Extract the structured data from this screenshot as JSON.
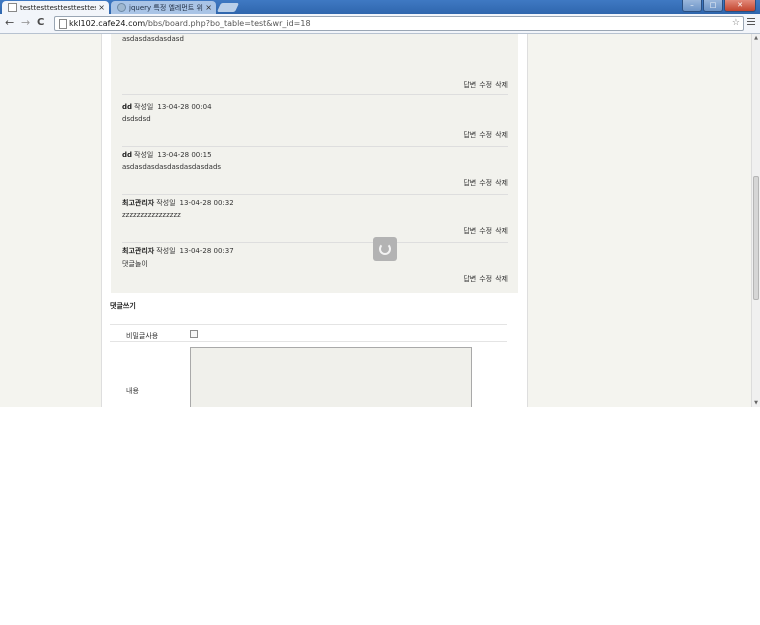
{
  "browser": {
    "tabs": [
      {
        "title": "testtesttesttesttesttesttest"
      },
      {
        "title": "jquery 특정 엘레먼트 위"
      }
    ],
    "tab_close": "×",
    "url_host": "kkl102.cafe24.com",
    "url_path": "/bbs/board.php?bo_table=test&wr_id=18",
    "nav": {
      "back": "←",
      "forward": "→",
      "reload": "C"
    },
    "star": "☆"
  },
  "comments": [
    {
      "author": "",
      "label": "",
      "date": "",
      "body": "asdasdasdasdasd"
    },
    {
      "author": "dd",
      "label": "작성일",
      "date": "13-04-28 00:04",
      "body": "dsdsdsd"
    },
    {
      "author": "dd",
      "label": "작성일",
      "date": "13-04-28 00:15",
      "body": "asdasdasdasdasdasdasdads"
    },
    {
      "author": "최고관리자",
      "label": "작성일",
      "date": "13-04-28 00:32",
      "body": "zzzzzzzzzzzzzzzz"
    },
    {
      "author": "최고관리자",
      "label": "작성일",
      "date": "13-04-28 00:37",
      "body": "댓글놀이"
    }
  ],
  "actions": {
    "reply": "답변",
    "edit": "수정",
    "delete": "삭제"
  },
  "form": {
    "title": "댓글쓰기",
    "secret_label": "비밀글사용",
    "content_label": "내용",
    "content_value": ""
  }
}
